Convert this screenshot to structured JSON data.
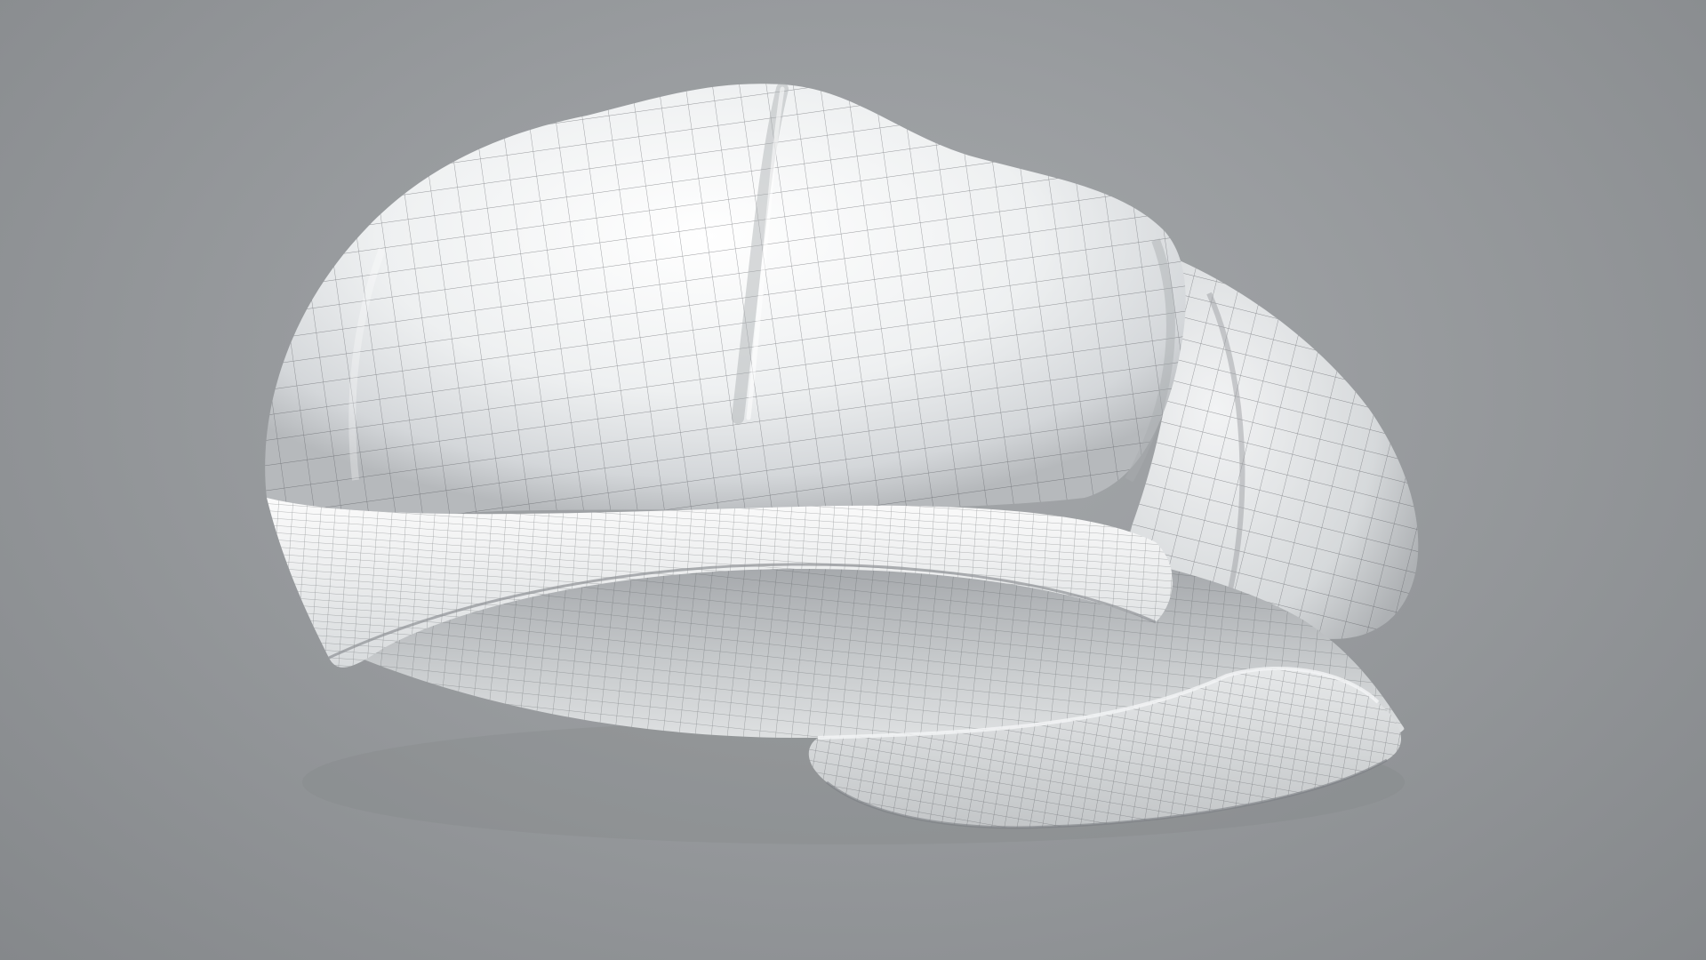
{
  "scene": {
    "subject": "cap-wireframe-model",
    "background_color": "#909396",
    "surface_color": "#f2f3f4",
    "wire_color": "#4a4d52",
    "shadow_color": "#b9bcbf"
  }
}
